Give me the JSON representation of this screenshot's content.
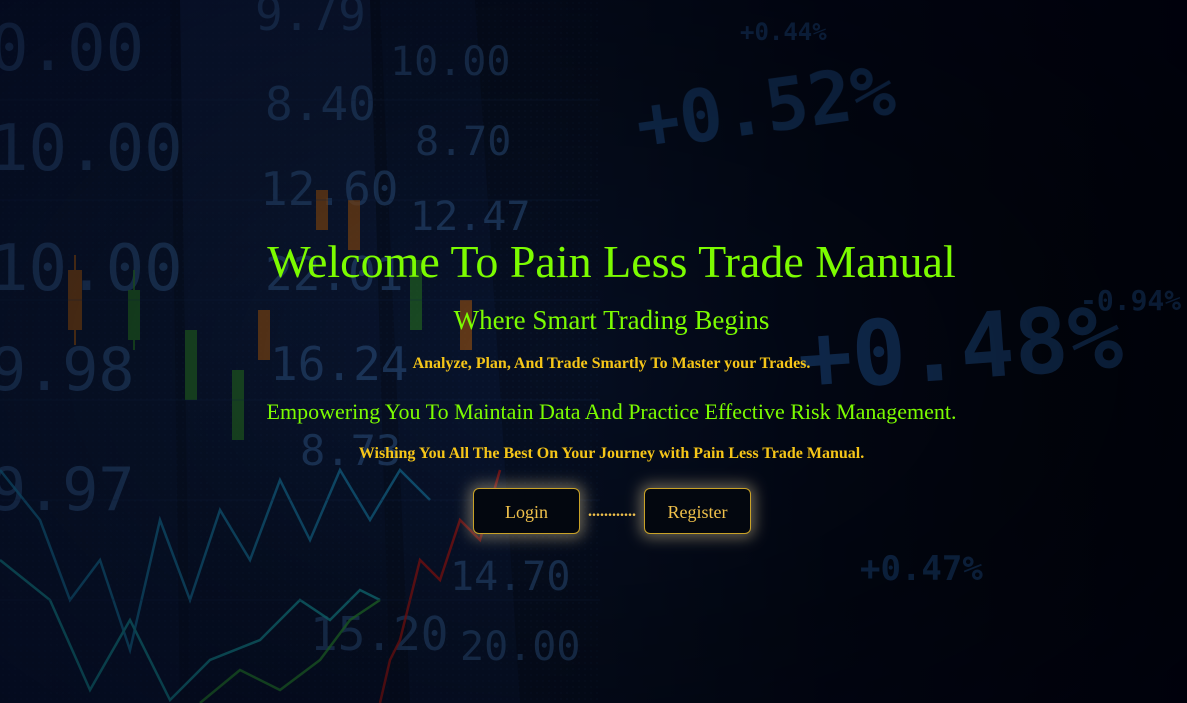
{
  "hero": {
    "title": "Welcome To Pain Less Trade Manual",
    "tagline": "Where Smart Trading Begins",
    "subtitle_1": "Analyze, Plan, And Trade Smartly To Master your Trades.",
    "subtitle_2": "Empowering You To Maintain Data And Practice Effective Risk Management.",
    "subtitle_3": "Wishing You All The Best On Your Journey with Pain Less Trade Manual."
  },
  "actions": {
    "login_label": "Login",
    "separator": "............",
    "register_label": "Register"
  },
  "background": {
    "ticker_values": [
      "0.00",
      "9.79",
      "8.40",
      "12.60",
      "22.01",
      "16.24",
      "8.73",
      "10.00",
      "8.70",
      "12.47",
      "14.70",
      "15.20",
      "20.00",
      "9.98",
      "9.97",
      "+0.52%",
      "+0.48%",
      "+0.47%",
      "-0.94%",
      "+0.44%"
    ]
  },
  "colors": {
    "heading_green": "#7cfc00",
    "accent_gold": "#f5c518",
    "button_border": "#c9a227",
    "page_background": "#030818"
  }
}
